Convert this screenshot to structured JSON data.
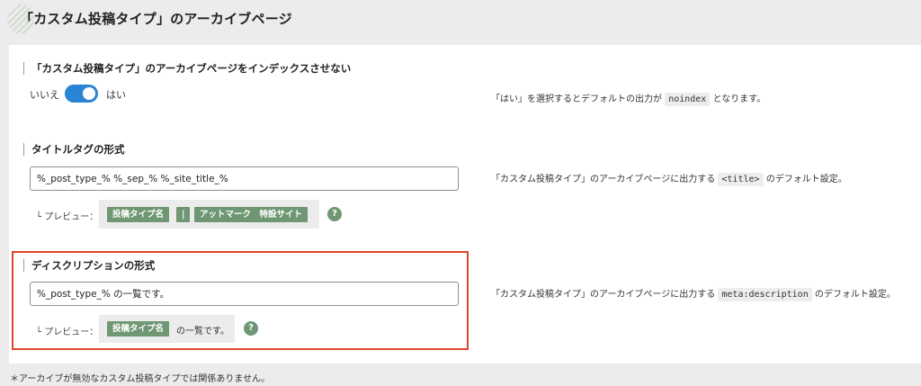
{
  "header": {
    "title": "「カスタム投稿タイプ」のアーカイブページ"
  },
  "noindex": {
    "title": "「カスタム投稿タイプ」のアーカイブページをインデックスさせない",
    "off_label": "いいえ",
    "on_label": "はい",
    "enabled": true,
    "note_before": "「はい」を選択するとデフォルトの出力が",
    "note_code": "noindex",
    "note_after": "となります。"
  },
  "title_tag": {
    "title": "タイトルタグの形式",
    "value": "%_post_type_% %_sep_% %_site_title_%",
    "preview_label": "└ プレビュー：",
    "preview_tags": [
      "投稿タイプ名",
      "|",
      "アットマーク　特設サイト"
    ],
    "help_icon": "?",
    "note_before": "「カスタム投稿タイプ」のアーカイブページに出力する",
    "note_code": "<title>",
    "note_after": "のデフォルト設定。"
  },
  "description": {
    "title": "ディスクリプションの形式",
    "value": "%_post_type_% の一覧です。",
    "preview_label": "└ プレビュー：",
    "preview_tag": "投稿タイプ名",
    "preview_text": "の一覧です。",
    "help_icon": "?",
    "note_before": "「カスタム投稿タイプ」のアーカイブページに出力する",
    "note_code": "meta:description",
    "note_after": "のデフォルト設定。"
  },
  "footer": {
    "note": "＊アーカイブが無効なカスタム投稿タイプでは関係ありません。"
  },
  "colors": {
    "accent": "#6f9773",
    "toggle": "#2a84d4",
    "highlight": "#e0452b"
  }
}
